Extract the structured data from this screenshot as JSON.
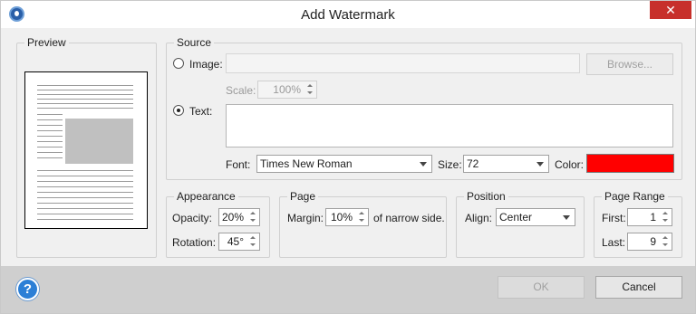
{
  "window": {
    "title": "Add Watermark",
    "close_glyph": "✕"
  },
  "preview": {
    "label": "Preview"
  },
  "source": {
    "label": "Source",
    "image_label": "Image:",
    "image_path": "",
    "browse_label": "Browse...",
    "scale_label": "Scale:",
    "scale_value": "100%",
    "text_label": "Text:",
    "text_value": "",
    "font_label": "Font:",
    "font_value": "Times New Roman",
    "size_label": "Size:",
    "size_value": "72",
    "color_label": "Color:",
    "color_value": "#ff0000",
    "selected": "text"
  },
  "appearance": {
    "label": "Appearance",
    "opacity_label": "Opacity:",
    "opacity_value": "20%",
    "rotation_label": "Rotation:",
    "rotation_value": "45°"
  },
  "page": {
    "label": "Page",
    "margin_label": "Margin:",
    "margin_value": "10%",
    "margin_suffix": "of narrow side."
  },
  "position": {
    "label": "Position",
    "align_label": "Align:",
    "align_value": "Center"
  },
  "page_range": {
    "label": "Page Range",
    "first_label": "First:",
    "first_value": "1",
    "last_label": "Last:",
    "last_value": "9"
  },
  "footer": {
    "help_glyph": "?",
    "ok_label": "OK",
    "cancel_label": "Cancel"
  }
}
